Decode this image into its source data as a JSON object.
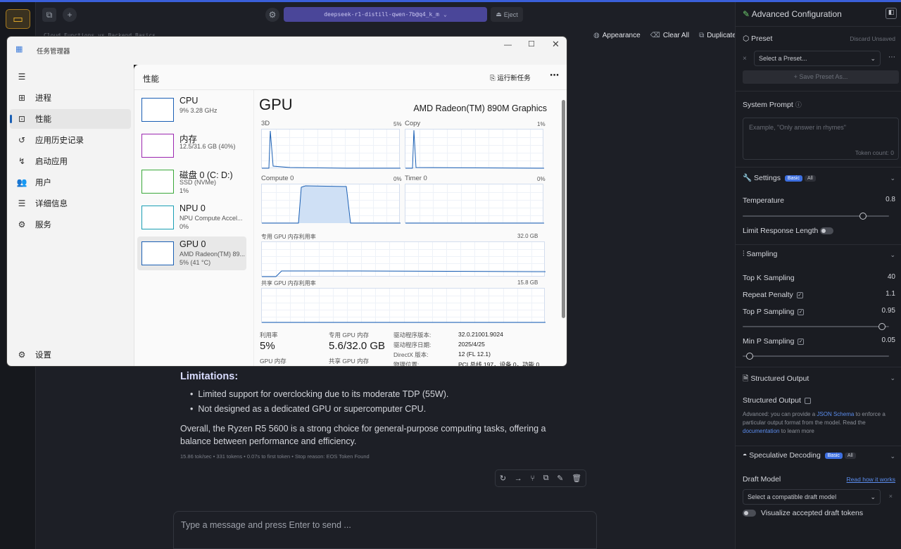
{
  "app": {
    "model_name": "deepseek-r1-distill-qwen-7b@q4_k_m",
    "eject_label": "Eject",
    "hint_text": "Cloud Functions vs Backend Basics"
  },
  "chat_actions": {
    "appearance": "Appearance",
    "clear_all": "Clear All",
    "duplicate": "Duplicate"
  },
  "message": {
    "limitations_title": "Limitations:",
    "bullets": [
      "Limited support for overclocking due to its moderate TDP (55W).",
      "Not designed as a dedicated GPU or supercomputer CPU."
    ],
    "paragraph": "Overall, the Ryzen R5 5600 is a strong choice for general-purpose computing tasks, offering a balance between performance and efficiency.",
    "stats": "15.86 tok/sec • 331 tokens • 0.07s to first token • Stop reason: EOS Token Found"
  },
  "input": {
    "placeholder": "Type a message and press Enter to send ..."
  },
  "panel": {
    "title": "Advanced Configuration",
    "preset_label": "Preset",
    "discard_label": "Discard Unsaved",
    "preset_select": "Select a Preset...",
    "save_preset": "+ Save Preset As...",
    "system_prompt_label": "System Prompt",
    "system_prompt_placeholder": "Example, \"Only answer in rhymes\"",
    "token_count": "Token count: 0",
    "settings_label": "Settings",
    "badge_basic": "Basic",
    "badge_all": "All",
    "temperature_label": "Temperature",
    "temperature_value": "0.8",
    "temperature_level": 0.82,
    "limit_length_label": "Limit Response Length",
    "sampling_label": "Sampling",
    "topk_label": "Top K Sampling",
    "topk_value": "40",
    "repeat_label": "Repeat Penalty",
    "repeat_value": "1.1",
    "topp_label": "Top P Sampling",
    "topp_value": "0.95",
    "topp_level": 0.95,
    "minp_label": "Min P Sampling",
    "minp_value": "0.05",
    "minp_level": 0.05,
    "structured_label": "Structured Output",
    "structured_check_label": "Structured Output",
    "structured_desc_1": "Advanced: you can provide a ",
    "structured_link_1": "JSON Schema",
    "structured_desc_2": " to enforce a particular output format from the model. Read the ",
    "structured_link_2": "documentation",
    "structured_desc_3": " to learn more",
    "spec_label": "Speculative Decoding",
    "draft_label": "Draft Model",
    "draft_link": "Read how it works",
    "draft_select": "Select a compatible draft model",
    "visualize_label": "Visualize accepted draft tokens"
  },
  "taskmgr": {
    "window_title": "任务管理器",
    "nav": [
      "进程",
      "性能",
      "应用历史记录",
      "启动应用",
      "用户",
      "详细信息",
      "服务"
    ],
    "settings": "设置",
    "page_title": "性能",
    "run_task": "运行新任务",
    "devices": [
      {
        "name": "CPU",
        "sub1": "9%  3.28 GHz",
        "sub2": ""
      },
      {
        "name": "内存",
        "sub1": "12.5/31.6 GB (40%)",
        "sub2": ""
      },
      {
        "name": "磁盘 0 (C: D:)",
        "sub1": "SSD (NVMe)",
        "sub2": "1%"
      },
      {
        "name": "NPU 0",
        "sub1": "NPU Compute Accel...",
        "sub2": "0%"
      },
      {
        "name": "GPU 0",
        "sub1": "AMD Radeon(TM) 89...",
        "sub2": "5% (41 °C)"
      }
    ],
    "gpu_title": "GPU",
    "gpu_model": "AMD Radeon(TM) 890M Graphics",
    "engines": [
      {
        "name": "3D",
        "pct": "5%"
      },
      {
        "name": "Copy",
        "pct": "1%"
      },
      {
        "name": "Compute 0",
        "pct": "0%"
      },
      {
        "name": "Timer 0",
        "pct": "0%"
      }
    ],
    "dedicated_label": "专用 GPU 内存利用率",
    "dedicated_max": "32.0 GB",
    "shared_label": "共享 GPU 内存利用率",
    "shared_max": "15.8 GB",
    "util_label": "利用率",
    "util_value": "5%",
    "gpumem_label": "专用 GPU 内存",
    "gpumem_value": "5.6/32.0 GB",
    "gpu_mem_label2": "GPU 内存",
    "shared_mem_label2": "共享 GPU 内存",
    "driver_ver_label": "驱动程序版本:",
    "driver_ver": "32.0.21001.9024",
    "driver_date_label": "驱动程序日期:",
    "driver_date": "2025/4/25",
    "directx_label": "DirectX 版本:",
    "directx": "12 (FL 12.1)",
    "location_label": "物理位置:",
    "location": "PCI 总线 197，设备 0，功能 0"
  },
  "colors": {
    "accent": "#3a5fd9",
    "model_pill": "#4a4699",
    "taskmgr_graph": "#1a5fb4"
  }
}
